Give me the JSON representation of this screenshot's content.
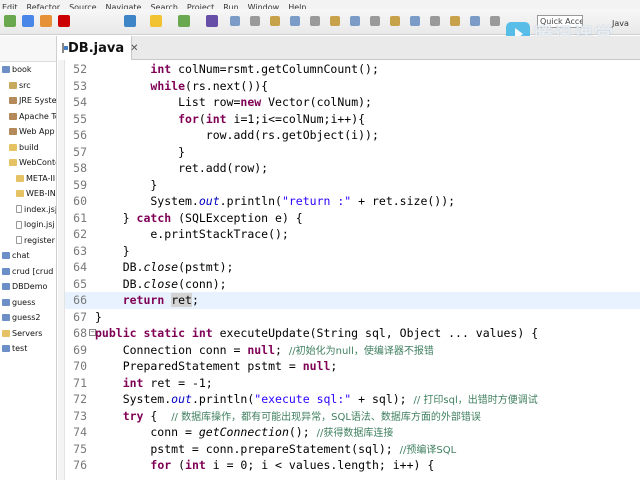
{
  "menu": [
    "Edit",
    "Refactor",
    "Source",
    "Navigate",
    "Search",
    "Project",
    "Run",
    "Window",
    "Help"
  ],
  "toolbar": {
    "quick_access_placeholder": "Quick Access",
    "perspective_label": "Java",
    "icon_colors": [
      "#6aa84f",
      "#4a86e8",
      "#e69138",
      "#cc0000",
      "#3d85c6",
      "#f1c232",
      "#6aa84f",
      "#674ea7"
    ]
  },
  "watermark": {
    "text": "腾讯课堂"
  },
  "explorer": {
    "items": [
      {
        "label": "book",
        "indent": 0,
        "icon": "project"
      },
      {
        "label": "src",
        "indent": 1,
        "icon": "pkg"
      },
      {
        "label": "JRE System",
        "indent": 1,
        "icon": "jar"
      },
      {
        "label": "Apache Tor",
        "indent": 1,
        "icon": "jar"
      },
      {
        "label": "Web App L",
        "indent": 1,
        "icon": "jar"
      },
      {
        "label": "build",
        "indent": 1,
        "icon": "folder"
      },
      {
        "label": "WebConter",
        "indent": 1,
        "icon": "folder"
      },
      {
        "label": "META-II",
        "indent": 2,
        "icon": "folder"
      },
      {
        "label": "WEB-IN",
        "indent": 2,
        "icon": "folder"
      },
      {
        "label": "index.jsj",
        "indent": 2,
        "icon": "file"
      },
      {
        "label": "login.jsj",
        "indent": 2,
        "icon": "file"
      },
      {
        "label": "register",
        "indent": 2,
        "icon": "file"
      },
      {
        "label": "chat",
        "indent": 0,
        "icon": "project"
      },
      {
        "label": "crud [crud",
        "indent": 0,
        "icon": "project"
      },
      {
        "label": "DBDemo",
        "indent": 0,
        "icon": "project"
      },
      {
        "label": "guess",
        "indent": 0,
        "icon": "project"
      },
      {
        "label": "guess2",
        "indent": 0,
        "icon": "project"
      },
      {
        "label": "Servers",
        "indent": 0,
        "icon": "folder"
      },
      {
        "label": "test",
        "indent": 0,
        "icon": "project"
      }
    ]
  },
  "editor": {
    "tab_label": "DB.java",
    "tab_close": "✕",
    "current_line": 66,
    "lines": [
      {
        "n": "52",
        "segs": [
          [
            "",
            "        "
          ],
          [
            "kw",
            "int"
          ],
          [
            "",
            " colNum=rsmt.getColumnCount();"
          ]
        ]
      },
      {
        "n": "53",
        "segs": [
          [
            "",
            "        "
          ],
          [
            "kw",
            "while"
          ],
          [
            "",
            "(rs.next()){"
          ]
        ]
      },
      {
        "n": "54",
        "segs": [
          [
            "",
            "            List row="
          ],
          [
            "kw",
            "new"
          ],
          [
            "",
            " Vector(colNum);"
          ]
        ]
      },
      {
        "n": "55",
        "segs": [
          [
            "",
            "            "
          ],
          [
            "kw",
            "for"
          ],
          [
            "",
            "("
          ],
          [
            "kw",
            "int"
          ],
          [
            "",
            " i=1;i<=colNum;i++){"
          ]
        ]
      },
      {
        "n": "56",
        "segs": [
          [
            "",
            "                row.add(rs.getObject(i));"
          ]
        ]
      },
      {
        "n": "57",
        "segs": [
          [
            "",
            "            }"
          ]
        ]
      },
      {
        "n": "58",
        "segs": [
          [
            "",
            "            ret.add(row);"
          ]
        ]
      },
      {
        "n": "59",
        "segs": [
          [
            "",
            "        }"
          ]
        ]
      },
      {
        "n": "60",
        "segs": [
          [
            "",
            "        System."
          ],
          [
            "fld",
            "out"
          ],
          [
            "",
            ".println("
          ],
          [
            "str",
            "\"return :\""
          ],
          [
            "",
            " + ret.size());"
          ]
        ]
      },
      {
        "n": "61",
        "segs": [
          [
            "",
            "    } "
          ],
          [
            "kw",
            "catch"
          ],
          [
            "",
            " (SQLException e) {"
          ]
        ]
      },
      {
        "n": "62",
        "segs": [
          [
            "",
            "        e.printStackTrace();"
          ]
        ]
      },
      {
        "n": "63",
        "segs": [
          [
            "",
            "    }"
          ]
        ]
      },
      {
        "n": "64",
        "segs": [
          [
            "",
            "    DB."
          ],
          [
            "it",
            "close"
          ],
          [
            "",
            "(pstmt);"
          ]
        ]
      },
      {
        "n": "65",
        "segs": [
          [
            "",
            "    DB."
          ],
          [
            "it",
            "close"
          ],
          [
            "",
            "(conn);"
          ]
        ]
      },
      {
        "n": "66",
        "segs": [
          [
            "",
            "    "
          ],
          [
            "kw",
            "return"
          ],
          [
            "",
            " "
          ],
          [
            "mk",
            "ret"
          ],
          [
            "",
            ";"
          ]
        ]
      },
      {
        "n": "67",
        "segs": [
          [
            "",
            "}"
          ]
        ]
      },
      {
        "n": "68",
        "fold": true,
        "segs": [
          [
            "kw",
            "public static int"
          ],
          [
            "",
            " executeUpdate(String sql, Object ... values) {"
          ]
        ]
      },
      {
        "n": "69",
        "segs": [
          [
            "",
            "    Connection conn = "
          ],
          [
            "kw",
            "null"
          ],
          [
            "",
            "; "
          ],
          [
            "cm",
            "//初始化为null，使编译器不报错"
          ]
        ]
      },
      {
        "n": "70",
        "segs": [
          [
            "",
            "    PreparedStatement pstmt = "
          ],
          [
            "kw",
            "null"
          ],
          [
            "",
            ";"
          ]
        ]
      },
      {
        "n": "71",
        "segs": [
          [
            "",
            "    "
          ],
          [
            "kw",
            "int"
          ],
          [
            "",
            " ret = -1;"
          ]
        ]
      },
      {
        "n": "72",
        "segs": [
          [
            "",
            "    System."
          ],
          [
            "fld",
            "out"
          ],
          [
            "",
            ".println("
          ],
          [
            "str",
            "\"execute sql:\""
          ],
          [
            "",
            " + sql); "
          ],
          [
            "cm",
            "// 打印sql，出错时方便调试"
          ]
        ]
      },
      {
        "n": "73",
        "segs": [
          [
            "",
            "    "
          ],
          [
            "kw",
            "try"
          ],
          [
            "",
            " {  "
          ],
          [
            "cm",
            "// 数据库操作，都有可能出现异常，SQL语法、数据库方面的外部错误"
          ]
        ]
      },
      {
        "n": "74",
        "segs": [
          [
            "",
            "        conn = "
          ],
          [
            "it",
            "getConnection"
          ],
          [
            "",
            "(); "
          ],
          [
            "cm",
            "//获得数据库连接"
          ]
        ]
      },
      {
        "n": "75",
        "segs": [
          [
            "",
            "        pstmt = conn.prepareStatement(sql); "
          ],
          [
            "cm",
            "//预编译SQL"
          ]
        ]
      },
      {
        "n": "76",
        "segs": [
          [
            "",
            "        "
          ],
          [
            "kw",
            "for"
          ],
          [
            "",
            " ("
          ],
          [
            "kw",
            "int"
          ],
          [
            "",
            " i = 0; i < values.length; i++) {"
          ]
        ]
      }
    ]
  }
}
